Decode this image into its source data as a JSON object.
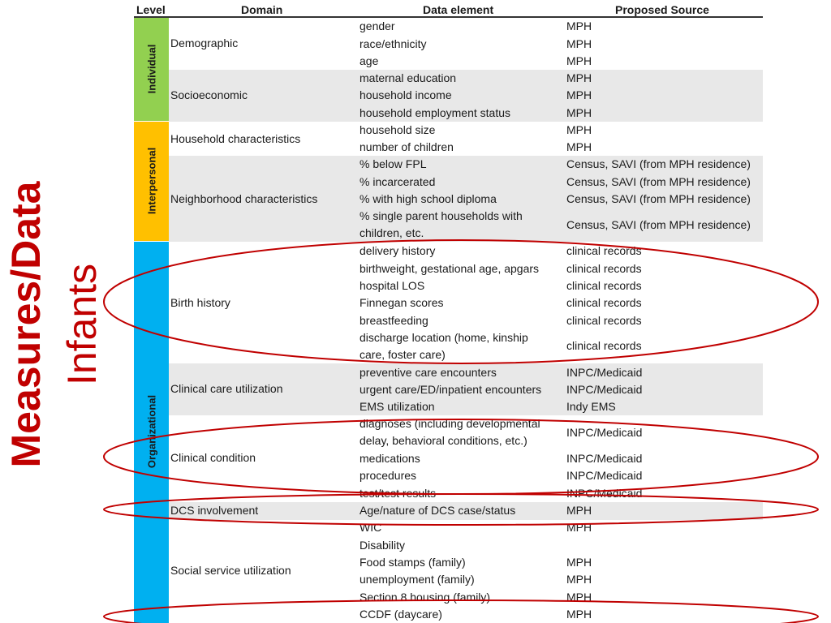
{
  "side_title": {
    "main": "Measures/Data",
    "sub": "Infants"
  },
  "headers": {
    "level": "Level",
    "domain": "Domain",
    "data_element": "Data element",
    "source": "Proposed Source"
  },
  "levels": {
    "individual": "Individual",
    "interpersonal": "Interpersonal",
    "organizational": "Organizational"
  },
  "colors": {
    "individual": "#92d050",
    "interpersonal": "#ffc000",
    "organizational": "#00b0f0",
    "title": "#c00000",
    "oval": "#c00000",
    "band": "#e8e8e8"
  },
  "domains": {
    "demographic": "Demographic",
    "socioeconomic": "Socioeconomic",
    "household": "Household characteristics",
    "neighborhood": "Neighborhood characteristics",
    "birth": "Birth history",
    "clinical_care": "Clinical care utilization",
    "clinical_condition": "Clinical condition",
    "dcs": "DCS involvement",
    "social_service": "Social service utilization"
  },
  "rows": [
    {
      "element": "gender",
      "source": "MPH"
    },
    {
      "element": "race/ethnicity",
      "source": "MPH"
    },
    {
      "element": "age",
      "source": "MPH"
    },
    {
      "element": "maternal education",
      "source": "MPH"
    },
    {
      "element": "household income",
      "source": "MPH"
    },
    {
      "element": "household employment status",
      "source": "MPH"
    },
    {
      "element": "household size",
      "source": "MPH"
    },
    {
      "element": "number of children",
      "source": "MPH"
    },
    {
      "element": "% below FPL",
      "source": "Census, SAVI (from MPH residence)"
    },
    {
      "element": "% incarcerated",
      "source": "Census, SAVI (from MPH residence)"
    },
    {
      "element": "% with high school diploma",
      "source": "Census, SAVI (from MPH residence)"
    },
    {
      "element": "% single parent households with children, etc.",
      "source": "Census, SAVI (from MPH residence)"
    },
    {
      "element": "delivery history",
      "source": "clinical records"
    },
    {
      "element": "birthweight, gestational age, apgars",
      "source": "clinical records"
    },
    {
      "element": "hospital LOS",
      "source": "clinical records"
    },
    {
      "element": "Finnegan scores",
      "source": "clinical records"
    },
    {
      "element": "breastfeeding",
      "source": "clinical records"
    },
    {
      "element": "discharge location (home, kinship care, foster care)",
      "source": "clinical records"
    },
    {
      "element": "preventive care encounters",
      "source": "INPC/Medicaid"
    },
    {
      "element": "urgent care/ED/inpatient encounters",
      "source": "INPC/Medicaid"
    },
    {
      "element": "EMS utilization",
      "source": "Indy EMS"
    },
    {
      "element": "diagnoses (including developmental delay, behavioral conditions, etc.)",
      "source": "INPC/Medicaid"
    },
    {
      "element": "medications",
      "source": "INPC/Medicaid"
    },
    {
      "element": "procedures",
      "source": "INPC/Medicaid"
    },
    {
      "element": "test/test results",
      "source": "INPC/Medicaid"
    },
    {
      "element": "Age/nature of DCS case/status",
      "source": "MPH"
    },
    {
      "element": "WIC",
      "source": "MPH"
    },
    {
      "element": "Disability",
      "source": ""
    },
    {
      "element": "Food stamps (family)",
      "source": "MPH"
    },
    {
      "element": "unemployment (family)",
      "source": "MPH"
    },
    {
      "element": "Section 8 housing (family)",
      "source": "MPH"
    },
    {
      "element": "CCDF (daycare)",
      "source": "MPH"
    }
  ]
}
